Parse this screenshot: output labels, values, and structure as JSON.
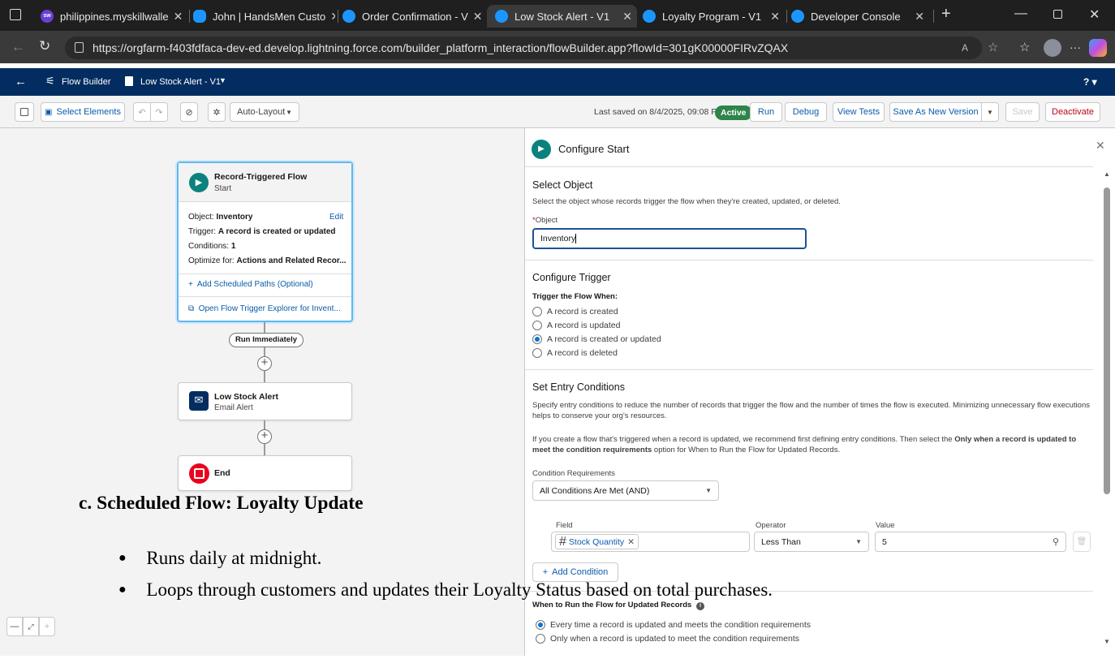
{
  "browser": {
    "tabs": [
      {
        "label": "philippines.myskillwalle",
        "fav_color": "#6b3fd8",
        "fav_text": "sw"
      },
      {
        "label": "John | HandsMen Custo",
        "fav_color": "#1b96ff"
      },
      {
        "label": "Order Confirmation - V",
        "fav_color": "#1b96ff"
      },
      {
        "label": "Low Stock Alert - V1",
        "fav_color": "#1b96ff"
      },
      {
        "label": "Loyalty Program - V1",
        "fav_color": "#1b96ff"
      },
      {
        "label": "Developer Console",
        "fav_color": "#1b96ff"
      }
    ],
    "url": "https://orgfarm-f403fdfaca-dev-ed.develop.lightning.force.com/builder_platform_interaction/flowBuilder.app?flowId=301gK00000FIRvZQAX"
  },
  "header": {
    "app_name": "Flow Builder",
    "flow_name": "Low Stock Alert - V1",
    "help": "?"
  },
  "toolbar": {
    "select_elements": "Select Elements",
    "layout": "Auto-Layout",
    "last_saved": "Last saved on 8/4/2025, 09:08 PM",
    "status": "Active",
    "run": "Run",
    "debug": "Debug",
    "view_tests": "View Tests",
    "save_as_new": "Save As New Version",
    "save": "Save",
    "deactivate": "Deactivate"
  },
  "canvas": {
    "start_title": "Record-Triggered Flow",
    "start_sub": "Start",
    "object_label": "Object:",
    "object_value": "Inventory",
    "edit": "Edit",
    "trigger_label": "Trigger:",
    "trigger_value": "A record is created or updated",
    "conditions_label": "Conditions:",
    "conditions_value": "1",
    "optimize_label": "Optimize for:",
    "optimize_value": "Actions and Related Recor...",
    "add_paths": "Add Scheduled Paths (Optional)",
    "open_explorer": "Open Flow Trigger Explorer for Invent...",
    "run_immediately": "Run Immediately",
    "alert_title": "Low Stock Alert",
    "alert_sub": "Email Alert",
    "end": "End"
  },
  "panel": {
    "title": "Configure Start",
    "select_object_heading": "Select Object",
    "select_object_desc": "Select the object whose records trigger the flow when they're created, updated, or deleted.",
    "object_label": "Object",
    "object_value": "Inventory",
    "configure_trigger_heading": "Configure Trigger",
    "trigger_when_label": "Trigger the Flow When:",
    "trigger_options": [
      "A record is created",
      "A record is updated",
      "A record is created or updated",
      "A record is deleted"
    ],
    "entry_heading": "Set Entry Conditions",
    "entry_desc1": "Specify entry conditions to reduce the number of records that trigger the flow and the number of times the flow is executed. Minimizing unnecessary flow executions helps to conserve your org's resources.",
    "entry_desc2_a": "If you create a flow that's triggered when a record is updated, we recommend first defining entry conditions. Then select the",
    "entry_desc2_b": "Only when a record is updated to meet the condition requirements",
    "entry_desc2_c": "option for When to Run the Flow for Updated Records.",
    "condition_req_label": "Condition Requirements",
    "condition_req_value": "All Conditions Are Met (AND)",
    "field_label": "Field",
    "operator_label": "Operator",
    "value_label": "Value",
    "field_value": "Stock Quantity",
    "operator_value": "Less Than",
    "value_value": "5",
    "add_condition": "Add Condition",
    "when_run_label": "When to Run the Flow for Updated Records",
    "when_run_options": [
      "Every time a record is updated and meets the condition requirements",
      "Only when a record is updated to meet the condition requirements"
    ]
  },
  "overlay": {
    "heading": "c. Scheduled Flow: Loyalty Update",
    "bullets": [
      "Runs daily at midnight.",
      "Loops through customers and updates their Loyalty Status based on total purchases."
    ]
  }
}
